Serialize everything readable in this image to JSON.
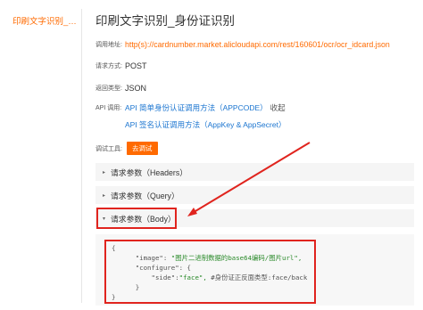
{
  "sidebar": {
    "active_item": "印刷文字识别_身..."
  },
  "page_title": "印刷文字识别_身份证识别",
  "request": {
    "address_label": "调用地址:",
    "address_value": "http(s)://cardnumber.market.alicloudapi.com/rest/160601/ocr/ocr_idcard.json",
    "method_label": "请求方式:",
    "method_value": "POST",
    "return_label": "返回类型:",
    "return_value": "JSON",
    "api_call_label": "API 调用:",
    "api_call_link1": "API 简单身份认证调用方法（APPCODE）",
    "collapse_label": "收起",
    "api_call_link2": "API 签名认证调用方法（AppKey & AppSecret）",
    "debug_tool_label": "调试工具:",
    "debug_button": "去调试"
  },
  "panels": [
    {
      "label": "请求参数（Headers）",
      "arrow": "▸"
    },
    {
      "label": "请求参数（Query）",
      "arrow": "▸"
    },
    {
      "label": "请求参数（Body）",
      "arrow": "▾"
    }
  ],
  "code": {
    "l1": "{",
    "l2_key": "\"image\": ",
    "l2_val": "\"图片二进制数据的base64编码/图片url\",",
    "l3_key": "\"configure\": {",
    "l4_key": "\"side\":",
    "l4_val": "\"face\",",
    "l4_comment": " #身份证正反面类型:face/back",
    "l5": "}",
    "l6": "}"
  },
  "colors": {
    "accent": "#ff6a00",
    "link": "#1b75d0",
    "annotation_red": "#e0241e"
  }
}
